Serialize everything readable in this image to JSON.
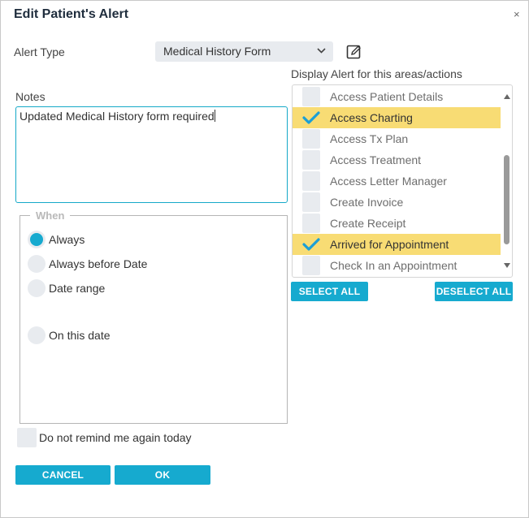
{
  "dialog": {
    "title": "Edit Patient's Alert",
    "close_glyph": "×"
  },
  "alert_type": {
    "label": "Alert Type",
    "value": "Medical History Form",
    "edit_icon": "pencil-square-icon"
  },
  "notes": {
    "label": "Notes",
    "value": "Updated Medical History form required"
  },
  "display_areas": {
    "label": "Display Alert for this areas/actions",
    "items": [
      {
        "label": "Access Patient Details",
        "checked": false
      },
      {
        "label": "Access Charting",
        "checked": true
      },
      {
        "label": "Access Tx Plan",
        "checked": false
      },
      {
        "label": "Access Treatment",
        "checked": false
      },
      {
        "label": "Access Letter Manager",
        "checked": false
      },
      {
        "label": "Create Invoice",
        "checked": false
      },
      {
        "label": "Create Receipt",
        "checked": false
      },
      {
        "label": "Arrived for Appointment",
        "checked": true
      },
      {
        "label": "Check In an Appointment",
        "checked": false
      }
    ],
    "select_all": "SELECT ALL",
    "deselect_all": "DESELECT ALL"
  },
  "when": {
    "legend": "When",
    "options": [
      {
        "label": "Always",
        "selected": true
      },
      {
        "label": "Always before Date",
        "selected": false
      },
      {
        "label": "Date range",
        "selected": false
      },
      {
        "label": "On this date",
        "selected": false
      }
    ]
  },
  "remind": {
    "label": "Do not remind me again today",
    "checked": false
  },
  "footer": {
    "cancel": "CANCEL",
    "ok": "OK"
  },
  "colors": {
    "accent": "#16aacf",
    "highlight": "#f8dc74",
    "check": "#1b9fd6"
  }
}
